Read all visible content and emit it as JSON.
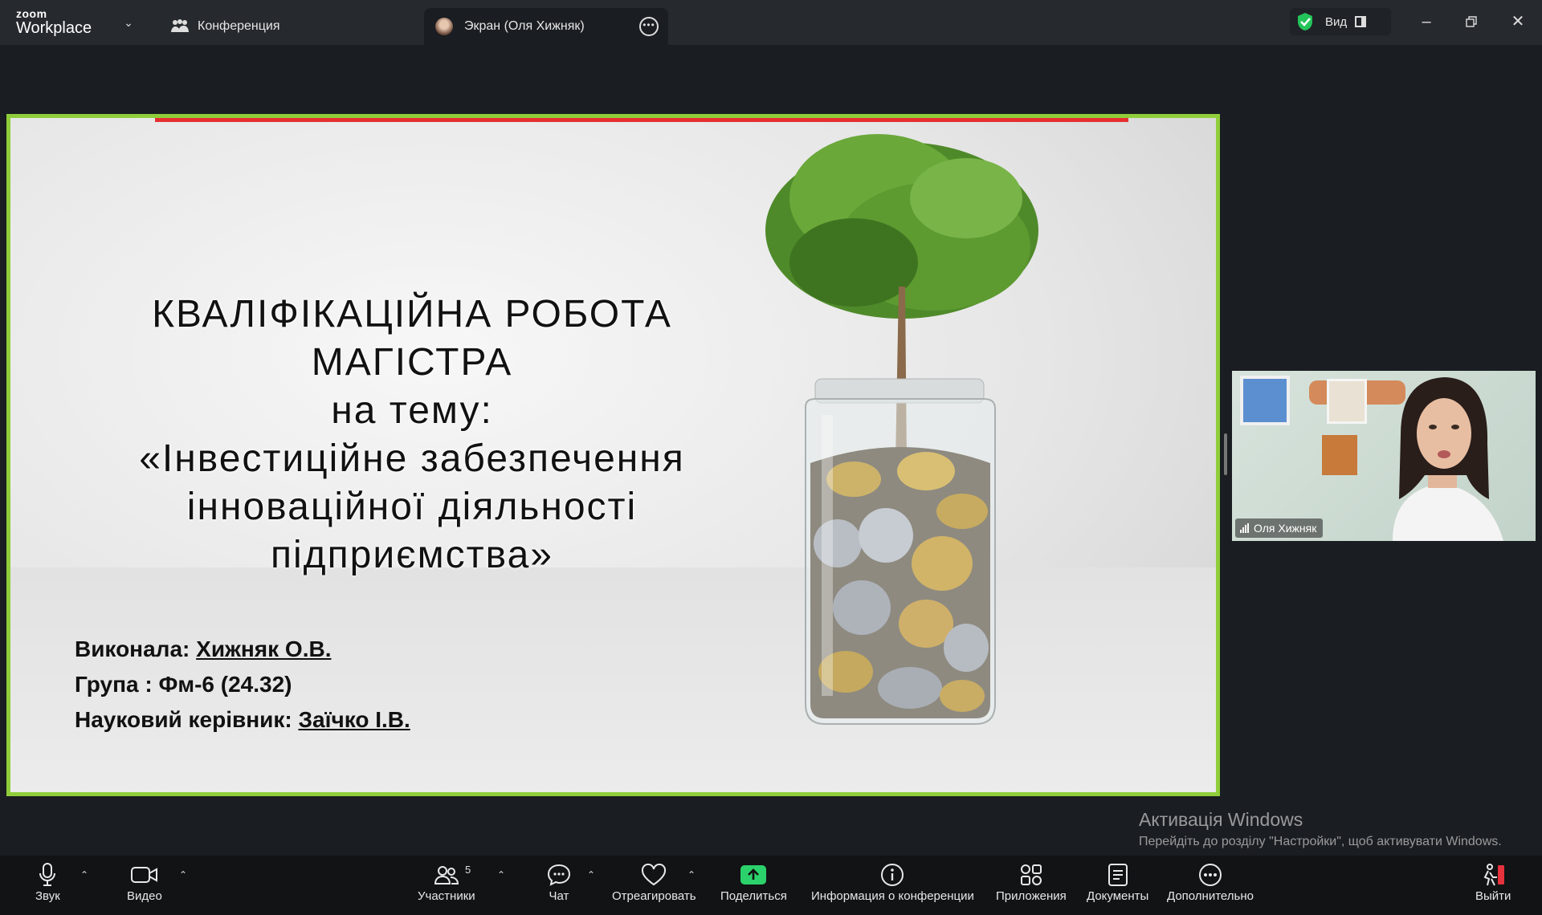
{
  "titlebar": {
    "brand_small": "zoom",
    "brand_big": "Workplace",
    "tab_conference": "Конференция",
    "tab_screen": "Экран (Оля Хижняк)",
    "view_label": "Вид"
  },
  "slide": {
    "title_line1": "КВАЛІФІКАЦІЙНА РОБОТА",
    "title_line2": "МАГІСТРА",
    "title_line3": "на тему:",
    "title_line4": "«Інвестиційне  забезпечення",
    "title_line5": "інноваційної діяльності",
    "title_line6": "підприємства»",
    "author_label": "Виконала:",
    "author_value": "Хижняк О.В.",
    "group_label": "Група : Фм-6 (24.32)",
    "advisor_label": "Науковий керівник:",
    "advisor_value": "Заїчко І.В."
  },
  "participant": {
    "name": "Оля Хижняк"
  },
  "watermark": {
    "title": "Активація Windows",
    "subtitle": "Перейдіть до розділу \"Настройки\", щоб активувати Windows."
  },
  "toolbar": {
    "audio": "Звук",
    "video": "Видео",
    "participants": "Участники",
    "participants_count": "5",
    "chat": "Чат",
    "react": "Отреагировать",
    "share": "Поделиться",
    "info": "Информация о конференции",
    "apps": "Приложения",
    "docs": "Документы",
    "more": "Дополнительно",
    "leave": "Выйти"
  },
  "colors": {
    "share_border": "#8fce3a",
    "share_top_bar": "#e53030",
    "share_button": "#2bd26b",
    "leave_icon": "#e5323d"
  }
}
